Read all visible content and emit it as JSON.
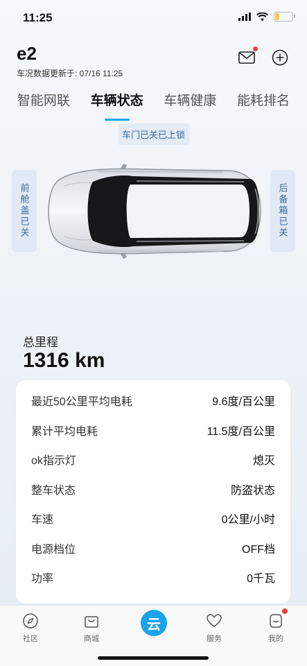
{
  "status_bar": {
    "time": "11:25"
  },
  "header": {
    "vehicle_name": "e2",
    "update_time": "车况数据更新于: 07/16 11:25"
  },
  "tabs": [
    {
      "label": "智能网联"
    },
    {
      "label": "车辆状态"
    },
    {
      "label": "车辆健康"
    },
    {
      "label": "能耗排名"
    }
  ],
  "car": {
    "door_lock": "车门已关已上锁",
    "front_hood": "前舱盖已关",
    "trunk": "后备箱已关"
  },
  "mileage": {
    "label": "总里程",
    "value": "1316 km"
  },
  "info": [
    {
      "label": "最近50公里平均电耗",
      "value": "9.6度/百公里"
    },
    {
      "label": "累计平均电耗",
      "value": "11.5度/百公里"
    },
    {
      "label": "ok指示灯",
      "value": "熄灭"
    },
    {
      "label": "整车状态",
      "value": "防盗状态"
    },
    {
      "label": "车速",
      "value": "0公里/小时"
    },
    {
      "label": "电源档位",
      "value": "OFF档"
    },
    {
      "label": "功率",
      "value": "0千瓦"
    }
  ],
  "nav": {
    "community": "社区",
    "mall": "商城",
    "center": "云",
    "service": "服务",
    "mine": "我的"
  },
  "colors": {
    "accent": "#1aa3ea",
    "notice": "#e8423a",
    "label_blue": "#3d6a9b"
  }
}
